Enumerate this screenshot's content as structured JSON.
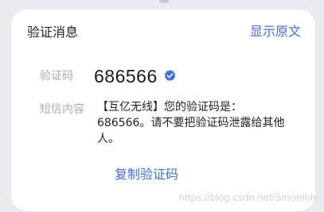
{
  "card": {
    "title": "验证消息",
    "show_original_label": "显示原文",
    "code_label": "验证码",
    "code_value": "686566",
    "sms_label": "短信内容",
    "sms_text": "【互亿无线】您的验证码是：686566。请不要把验证码泄露给其他人。",
    "copy_label": "复制验证码"
  },
  "watermark": "https://blog.csdn.net/Smoothh",
  "icons": {
    "verified": "verified-badge-icon"
  },
  "colors": {
    "accent": "#3d6fe6",
    "label": "#a7abb3",
    "text": "#1d1f23"
  }
}
